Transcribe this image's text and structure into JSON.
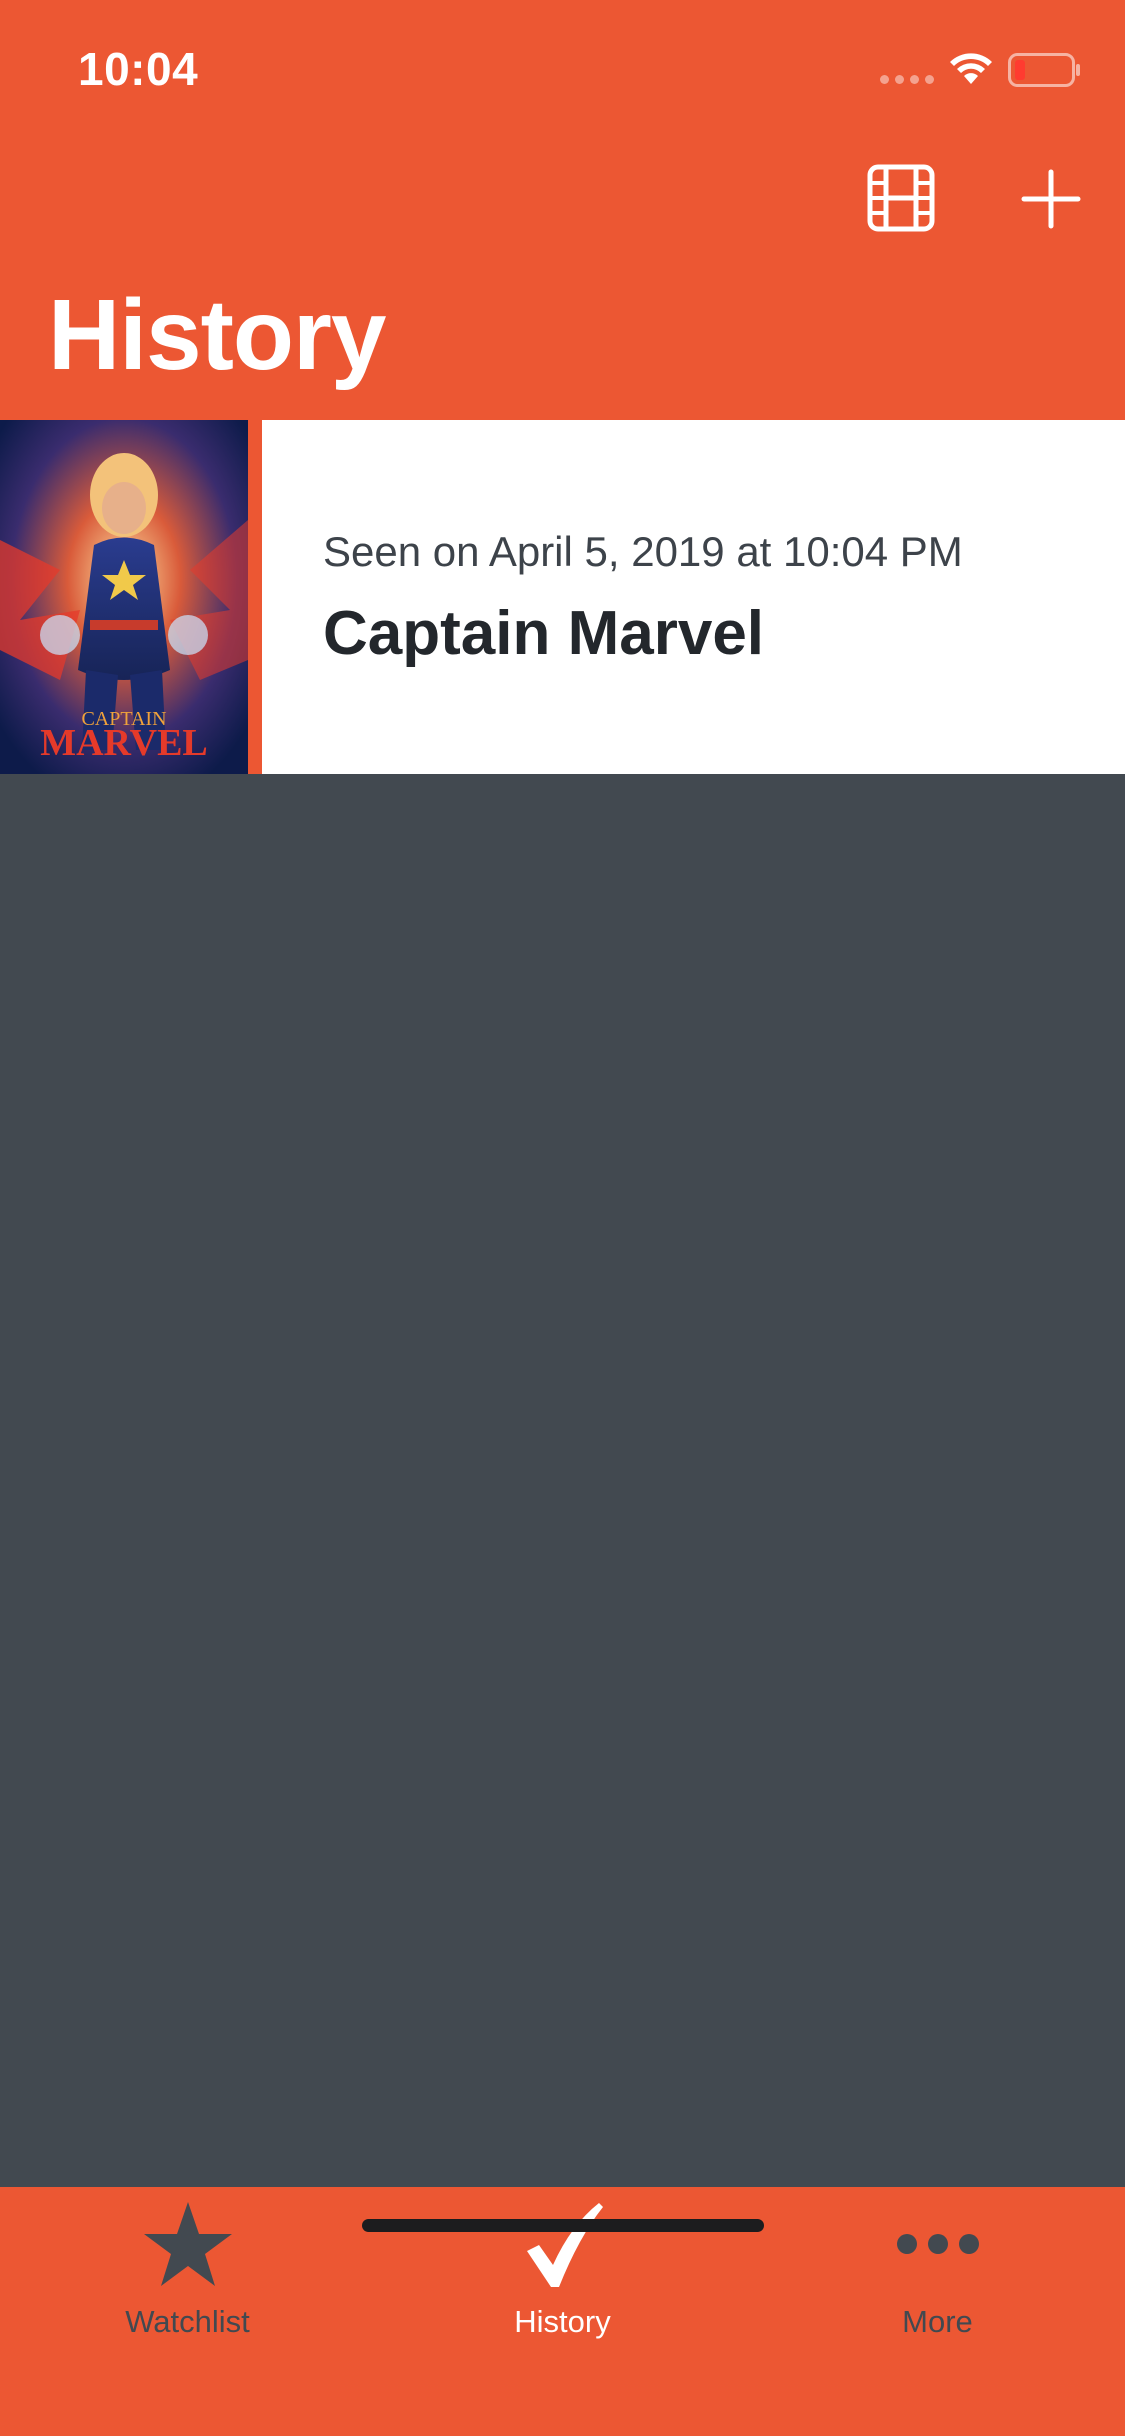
{
  "status_bar": {
    "time": "10:04"
  },
  "nav": {
    "title": "History",
    "film_icon": "film-icon",
    "add_icon": "plus-icon"
  },
  "history": {
    "items": [
      {
        "seen": "Seen on April 5, 2019 at 10:04 PM",
        "title": "Captain Marvel",
        "poster_text_top": "CAPTAIN",
        "poster_text_bottom": "MARVEL"
      }
    ]
  },
  "tabs": [
    {
      "label": "Watchlist",
      "icon": "star-icon",
      "selected": false
    },
    {
      "label": "History",
      "icon": "checkmark-icon",
      "selected": true
    },
    {
      "label": "More",
      "icon": "more-dots-icon",
      "selected": false
    }
  ],
  "colors": {
    "accent": "#EC5733",
    "background": "#424950",
    "tab_inactive": "#424950",
    "tab_active": "#FFFFFF"
  }
}
